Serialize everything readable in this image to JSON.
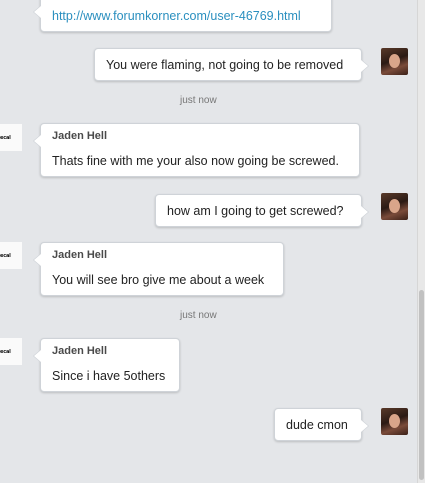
{
  "messages": [
    {
      "dir": "in",
      "text": "http://www.forumkorner.com/user-46769.html"
    },
    {
      "dir": "out",
      "text": "You were flaming, not going to be removed"
    },
    {
      "dir": "in",
      "sender": "Jaden Hell",
      "text": "Thats fine with me your also now going be screwed."
    },
    {
      "dir": "out",
      "text": "how am I going to get screwed?"
    },
    {
      "dir": "in",
      "sender": "Jaden Hell",
      "text": "You will see bro give me about a week"
    },
    {
      "dir": "in",
      "sender": "Jaden Hell",
      "text": "Since i have 5others"
    },
    {
      "dir": "out",
      "text": "dude cmon"
    }
  ],
  "timestamps": [
    "just now",
    "just now"
  ],
  "avatar_logo_text": "ecal",
  "colors": {
    "background": "#e4e6e9",
    "link": "#2a8fbf",
    "bubble": "#ffffff"
  }
}
